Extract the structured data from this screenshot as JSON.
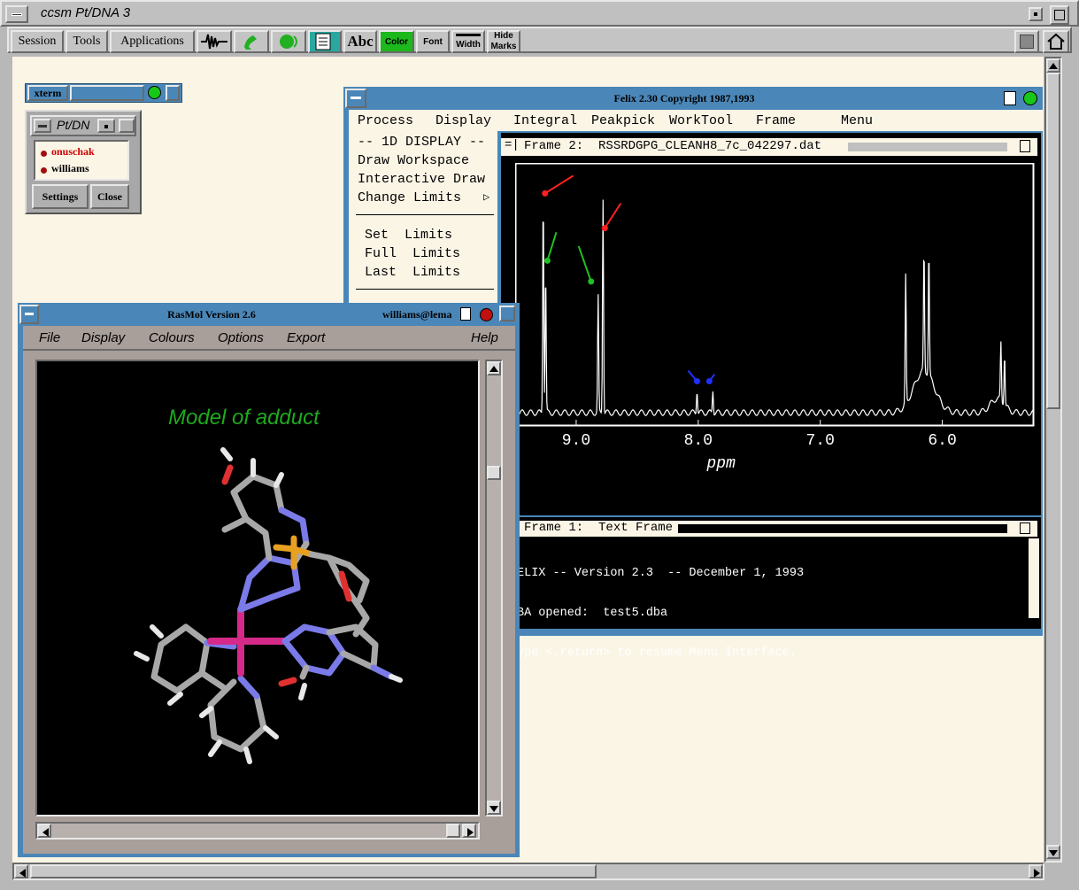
{
  "session": {
    "title": "ccsm Pt/DNA 3"
  },
  "toolbar": {
    "menus": [
      "Session",
      "Tools",
      "Applications"
    ],
    "abc_label": "Abc",
    "color_label": "Color",
    "font_label": "Font",
    "width_label": "Width",
    "hide_marks_label": "Hide Marks"
  },
  "xterm": {
    "title": "xterm"
  },
  "ptdna": {
    "title": "Pt/DN",
    "users": [
      "onuschak",
      "williams"
    ],
    "settings_label": "Settings",
    "close_label": "Close",
    "colors": {
      "user1": "#cc0000",
      "user2": "#000000"
    }
  },
  "felix": {
    "title": "Felix 2.30  Copyright 1987,1993",
    "menus": [
      "Process",
      "Display",
      "Integral",
      "Peakpick",
      "WorkTool",
      "Frame",
      "Menu"
    ],
    "side_header": "-- 1D DISPLAY --",
    "side_items": [
      "Draw Workspace",
      "Interactive Draw",
      "Change Limits"
    ],
    "limit_items": [
      "Set  Limits",
      "Full  Limits",
      "Last  Limits"
    ],
    "frame2_title": "Frame 2:  RSSRDGPG_CLEANH8_7c_042297.dat",
    "frame1_title": "Frame 1:  Text Frame",
    "text_lines": [
      "ELIX -- Version 2.3  -- December 1, 1993",
      "BA opened:  test5.dba",
      "ype <.return> to resume Menu Interface."
    ]
  },
  "rasmol": {
    "title": "RasMol Version 2.6",
    "user": "williams@lema",
    "menus": [
      "File",
      "Display",
      "Colours",
      "Options",
      "Export"
    ],
    "help_label": "Help",
    "model_label": "Model of adduct"
  },
  "chart_data": {
    "type": "line",
    "xlabel": "ppm",
    "x_ticks": [
      "9.0",
      "8.0",
      "7.0",
      "6.0"
    ],
    "xlim": [
      9.5,
      5.25
    ],
    "x_reversed": true,
    "peaks": [
      {
        "ppm": 9.27,
        "height": 0.93
      },
      {
        "ppm": 9.25,
        "height": 0.6
      },
      {
        "ppm": 8.78,
        "height": 0.93
      },
      {
        "ppm": 8.82,
        "height": 0.5
      },
      {
        "ppm": 8.01,
        "height": 0.1
      },
      {
        "ppm": 7.88,
        "height": 0.1
      },
      {
        "ppm": 6.3,
        "height": 0.55
      },
      {
        "ppm": 6.15,
        "height": 0.52
      },
      {
        "ppm": 6.11,
        "height": 0.54
      },
      {
        "ppm": 5.52,
        "height": 0.25
      },
      {
        "ppm": 5.49,
        "height": 0.22
      }
    ],
    "arrows": [
      {
        "color": "#ff2020",
        "points_to_ppm": 9.27
      },
      {
        "color": "#ff2020",
        "points_to_ppm": 8.78
      },
      {
        "color": "#20c020",
        "points_to_ppm": 9.25
      },
      {
        "color": "#20c020",
        "points_to_ppm": 8.82
      },
      {
        "color": "#2030ff",
        "points_to_ppm": 8.01
      },
      {
        "color": "#2030ff",
        "points_to_ppm": 7.88
      }
    ]
  }
}
